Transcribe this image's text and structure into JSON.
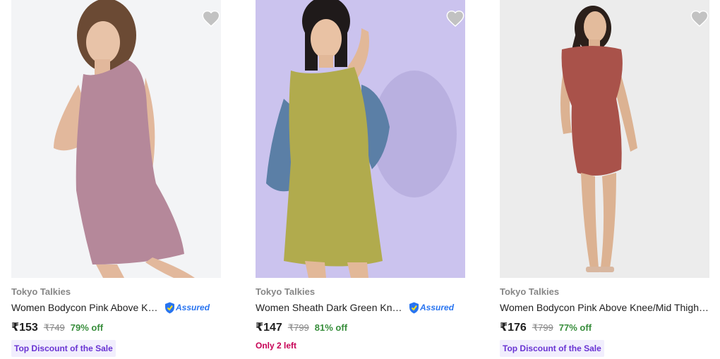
{
  "products": [
    {
      "brand": "Tokyo Talkies",
      "title": "Women Bodycon Pink Above Knee/Mid Thigh Dress",
      "assured": true,
      "assured_label": "Assured",
      "price": "₹153",
      "mrp": "₹749",
      "discount": "79% off",
      "tag": "Top Discount of the Sale",
      "image_bg": "#f3f4f6",
      "dress_color": "#b5889a"
    },
    {
      "brand": "Tokyo Talkies",
      "title": "Women Sheath Dark Green Knee Length Dress",
      "assured": true,
      "assured_label": "Assured",
      "price": "₹147",
      "mrp": "₹799",
      "discount": "81% off",
      "stock": "Only 2 left",
      "image_bg": "#cbc3ee",
      "dress_color": "#b1ab4d",
      "jacket_color": "#5b7fa6"
    },
    {
      "brand": "Tokyo Talkies",
      "title": "Women Bodycon Pink Above Knee/Mid Thigh Dress",
      "assured": false,
      "price": "₹176",
      "mrp": "₹799",
      "discount": "77% off",
      "tag": "Top Discount of the Sale",
      "image_bg": "#ececec",
      "dress_color": "#a9524a"
    }
  ],
  "icons": {
    "wishlist": "heart-icon",
    "assured": "shield-icon"
  },
  "colors": {
    "heart": "#c2c2c2",
    "assured_blue": "#2874f0",
    "discount_green": "#388e3c",
    "tag_bg": "#f1eefd",
    "tag_text": "#6933d3",
    "stock_text": "#c70055"
  }
}
